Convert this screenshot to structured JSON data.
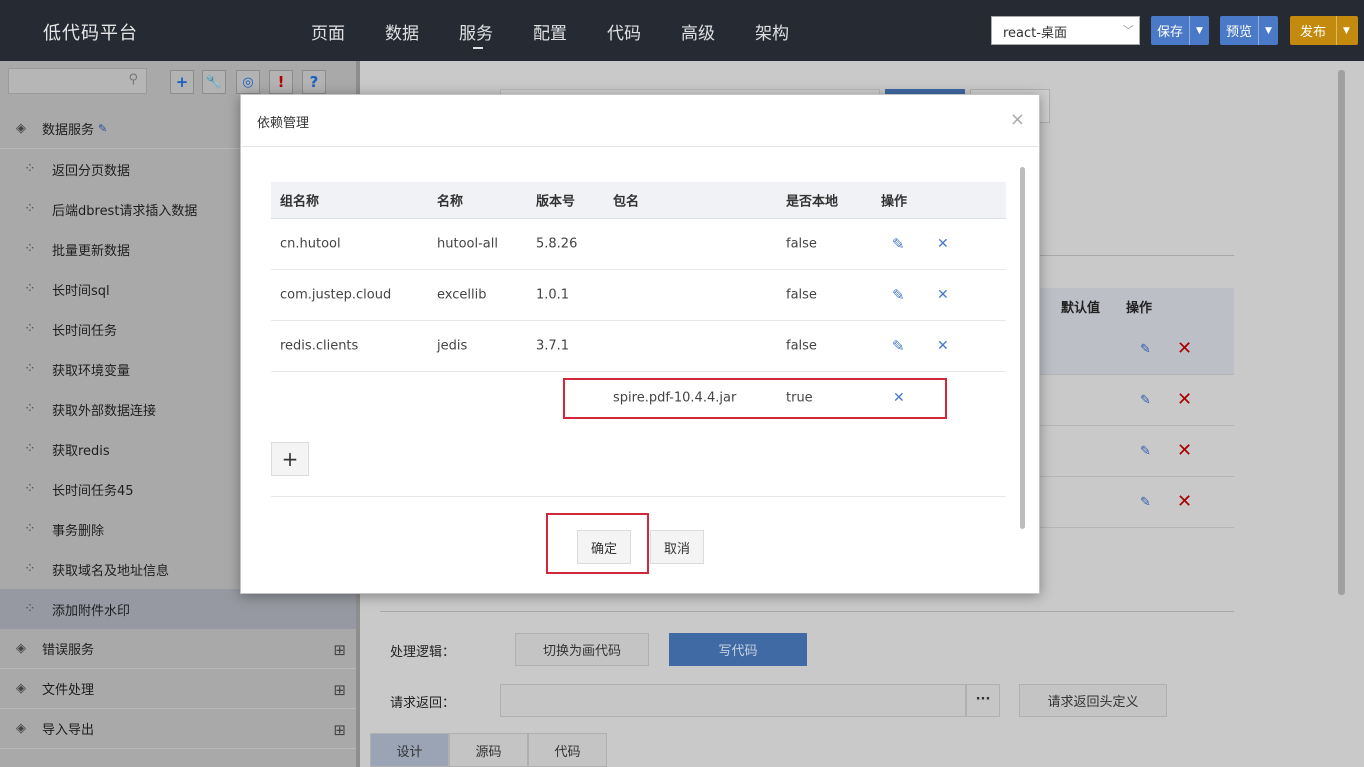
{
  "app": {
    "brand": "低代码平台"
  },
  "nav": [
    {
      "label": "页面"
    },
    {
      "label": "数据"
    },
    {
      "label": "服务"
    },
    {
      "label": "配置"
    },
    {
      "label": "代码"
    },
    {
      "label": "高级"
    },
    {
      "label": "架构"
    }
  ],
  "header": {
    "env_select": "react-桌面",
    "save": "保存",
    "preview": "预览",
    "publish": "发布"
  },
  "sidebar": {
    "tools": [
      "+",
      "wrench-icon",
      "target-icon",
      "!",
      "?"
    ],
    "group_data": "数据服务",
    "items": [
      "返回分页数据",
      "后端dbrest请求插入数据",
      "批量更新数据",
      "长时间sql",
      "长时间任务",
      "获取环境变量",
      "获取外部数据连接",
      "获取redis",
      "长时间任务45",
      "事务删除",
      "获取域名及地址信息",
      "添加附件水印"
    ],
    "other_groups": [
      "错误服务",
      "文件处理",
      "导入导出"
    ]
  },
  "main": {
    "table_head": {
      "default": "默认值",
      "ops": "操作"
    },
    "logic_label": "处理逻辑：",
    "switch_btn": "切换为画代码",
    "write_btn": "写代码",
    "return_label": "请求返回：",
    "more": "···",
    "header_def_btn": "请求返回头定义",
    "tabs": [
      "设计",
      "源码",
      "代码"
    ]
  },
  "modal": {
    "title": "依赖管理",
    "close": "×",
    "columns": [
      "组名称",
      "名称",
      "版本号",
      "包名",
      "是否本地",
      "操作"
    ],
    "rows": [
      {
        "group": "cn.hutool",
        "name": "hutool-all",
        "version": "5.8.26",
        "package": "",
        "local": "false"
      },
      {
        "group": "com.justep.cloud",
        "name": "excellib",
        "version": "1.0.1",
        "package": "",
        "local": "false"
      },
      {
        "group": "redis.clients",
        "name": "jedis",
        "version": "3.7.1",
        "package": "",
        "local": "false"
      }
    ],
    "new_row": {
      "package": "spire.pdf-10.4.4.jar",
      "local": "true"
    },
    "add": "+",
    "confirm": "确定",
    "cancel": "取消"
  }
}
